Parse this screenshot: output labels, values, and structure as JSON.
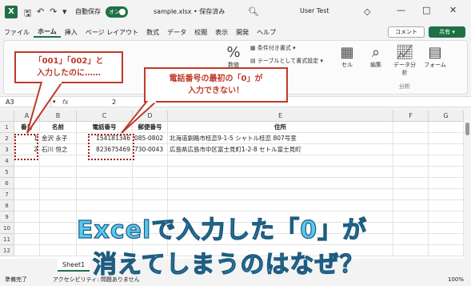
{
  "titlebar": {
    "app_logo": "X",
    "autosave_label": "自動保存",
    "autosave_state": "オン",
    "doc_title": "sample.xlsx • 保存済み",
    "user": "User Test"
  },
  "menu": [
    "ファイル",
    "ホーム",
    "挿入",
    "ページ レイアウト",
    "数式",
    "データ",
    "校閲",
    "表示",
    "開発",
    "ヘルプ"
  ],
  "menu_active": "ホーム",
  "comment_label": "コメント",
  "share_label": "共有",
  "ribbon": {
    "number_label": "数値",
    "cond_format": "条件付き書式",
    "table_format": "テーブルとして書式設定",
    "cell_label": "セル",
    "edit_label": "編集",
    "analysis_label": "データ分析",
    "analysis_group": "分析",
    "form_label": "フォーム"
  },
  "formula": {
    "namebox": "A3",
    "fx": "fx",
    "value": "2"
  },
  "columns": [
    "A",
    "B",
    "C",
    "D",
    "E",
    "F",
    "G"
  ],
  "rows": [
    "1",
    "2",
    "3",
    "4",
    "5",
    "6",
    "7",
    "8",
    "9",
    "10",
    "11",
    "12"
  ],
  "table": {
    "header": [
      "番号",
      "名前",
      "電話番号",
      "郵便番号",
      "住所"
    ],
    "rows": [
      [
        "1",
        "金沢 永子",
        "154181346",
        "085-0802",
        "北海道釧路市桂恋9-1-5 シャトル桂恋 807号室"
      ],
      [
        "2",
        "石川 恒之",
        "823675469",
        "730-0043",
        "広島県広島市中区富士見町1-2-8 セトル富士見町"
      ]
    ]
  },
  "sheet_tab": "Sheet1",
  "status": {
    "ready": "準備完了",
    "accessibility": "アクセシビリティ: 問題ありません",
    "zoom": "100%"
  },
  "callouts": {
    "left": [
      "「001」「002」と",
      "入力したのに……"
    ],
    "right": [
      "電話番号の最初の「0」が",
      "入力できない！"
    ]
  },
  "headline": [
    "Excelで入力した「0」が",
    "消えてしまうのはなぜ？"
  ]
}
